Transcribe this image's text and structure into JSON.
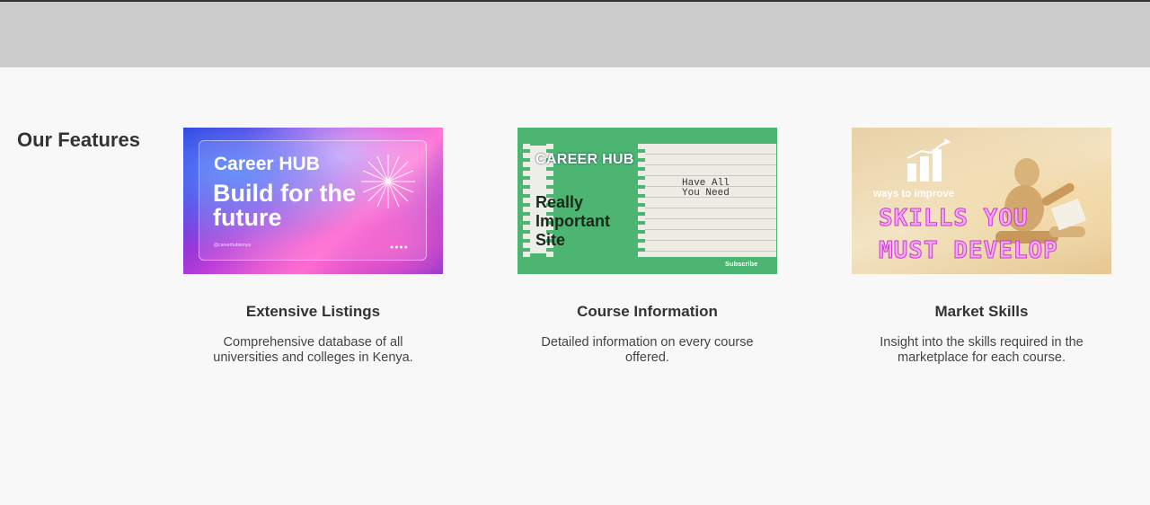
{
  "section": {
    "title": "Our Features"
  },
  "features": [
    {
      "title": "Extensive Listings",
      "description": "Comprehensive database of all universities and colleges in Kenya.",
      "image": {
        "line1": "Career HUB",
        "line2": "Build for the future",
        "small": "@careerhubkenya",
        "dots": "●●●●"
      }
    },
    {
      "title": "Course Information",
      "description": "Detailed information on every course offered.",
      "image": {
        "line1": "CAREER HUB",
        "line2": "Really Important Site",
        "note": "Have All\nYou Need",
        "subscribe": "Subscribe"
      }
    },
    {
      "title": "Market Skills",
      "description": "Insight into the skills required in the marketplace for each course.",
      "image": {
        "line1": "ways to improve",
        "line2": "SKILLS YOU MUST DEVELOP"
      }
    }
  ],
  "colors": {
    "top_bar": "#cccccc",
    "background": "#f8f8f8",
    "green": "#4cb572"
  }
}
